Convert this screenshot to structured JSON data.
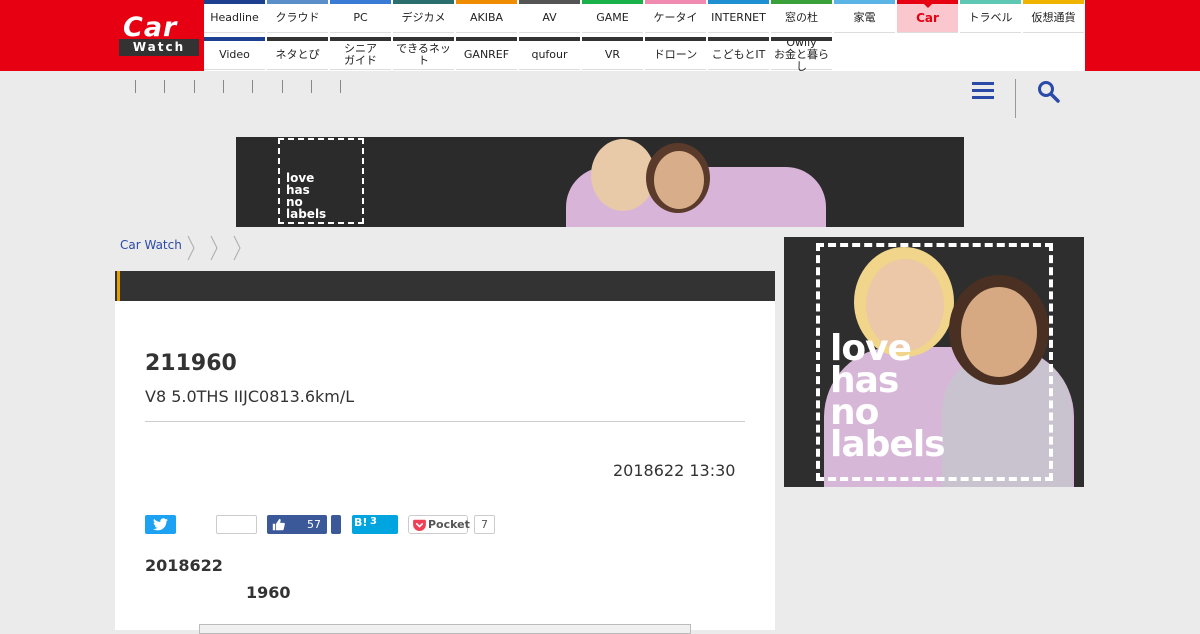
{
  "site": {
    "logo_top": "Car",
    "logo_bottom": "Watch"
  },
  "nav": {
    "row1": [
      {
        "label": "Headline",
        "color": "#1d3f8f"
      },
      {
        "label": "クラウド",
        "color": "#5a8fc9"
      },
      {
        "label": "PC",
        "color": "#3a7bd5"
      },
      {
        "label": "デジカメ",
        "color": "#2a6e6e"
      },
      {
        "label": "AKIBA",
        "color": "#f08c00"
      },
      {
        "label": "AV",
        "color": "#555555"
      },
      {
        "label": "GAME",
        "color": "#1ab04a"
      },
      {
        "label": "ケータイ",
        "color": "#f08ab0"
      },
      {
        "label": "INTERNET",
        "color": "#1e90d2"
      },
      {
        "label": "窓の杜",
        "color": "#3aa03a"
      },
      {
        "label": "家電",
        "color": "#5ab4e6"
      },
      {
        "label": "Car",
        "color": "#e60012",
        "active": true
      },
      {
        "label": "トラベル",
        "color": "#5ec8b4"
      },
      {
        "label": "仮想通貨",
        "color": "#f0b400"
      }
    ],
    "row2": [
      {
        "label": "Video",
        "color": "#1d3f8f"
      },
      {
        "label": "ネタとぴ",
        "color": "#333333"
      },
      {
        "label": "シニア\nガイド",
        "color": "#333333"
      },
      {
        "label": "できるネット",
        "color": "#333333"
      },
      {
        "label": "GANREF",
        "color": "#333333"
      },
      {
        "label": "qufour",
        "color": "#333333"
      },
      {
        "label": "VR",
        "color": "#333333"
      },
      {
        "label": "ドローン",
        "color": "#333333"
      },
      {
        "label": "こどもとIT",
        "color": "#333333"
      },
      {
        "label": "Owlly\nお金と暮らし",
        "color": "#333333"
      }
    ]
  },
  "banner": {
    "text_lines": [
      "love",
      "has",
      "no",
      "labels"
    ]
  },
  "side_ad": {
    "text_lines": [
      "love",
      "has",
      "no",
      "labels"
    ]
  },
  "breadcrumb": {
    "home": "Car Watch"
  },
  "article": {
    "title": "211960",
    "subtitle": "V8 5.0THS IIJC0813.6km/L",
    "date": "2018622 13:30",
    "body_line1": "2018622",
    "body_line2": "1960"
  },
  "share": {
    "facebook_count": "57",
    "hatena_label": "B!",
    "hatena_count": "3",
    "pocket_label": "Pocket",
    "pocket_count": "7"
  },
  "colors": {
    "brand": "#e60012",
    "link": "#2b4aa8"
  }
}
